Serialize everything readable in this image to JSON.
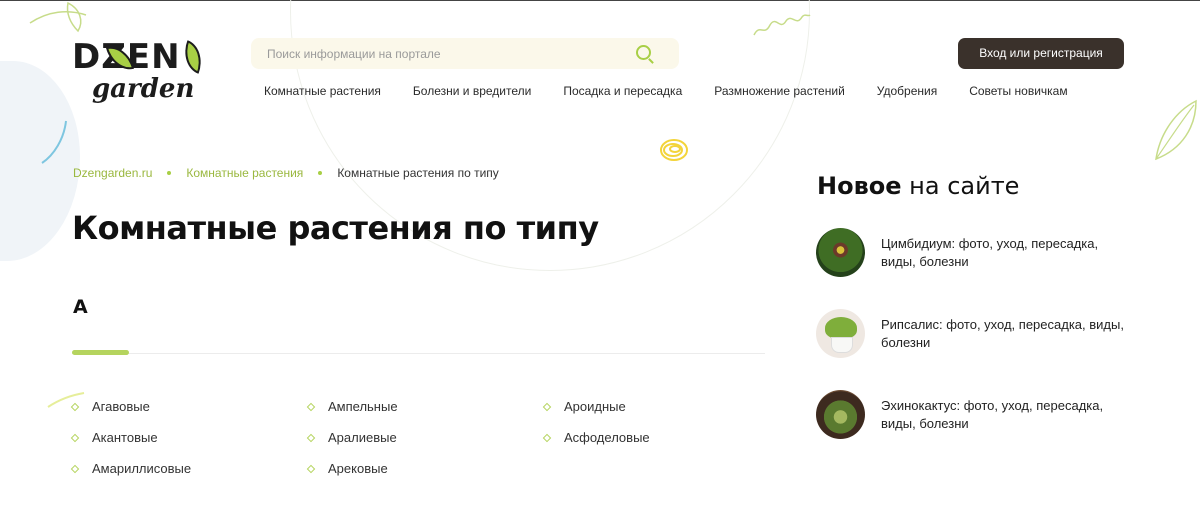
{
  "header": {
    "logo": {
      "top": "DZEN",
      "bottom": "garden"
    },
    "search": {
      "placeholder": "Поиск информации на портале"
    },
    "login_label": "Вход или регистрация",
    "nav": [
      {
        "label": "Комнатные растения"
      },
      {
        "label": "Болезни и вредители"
      },
      {
        "label": "Посадка и пересадка"
      },
      {
        "label": "Размножение растений"
      },
      {
        "label": "Удобрения"
      },
      {
        "label": "Советы новичкам"
      }
    ]
  },
  "breadcrumb": [
    {
      "label": "Dzengarden.ru"
    },
    {
      "label": "Комнатные растения"
    },
    {
      "label": "Комнатные растения по типу"
    }
  ],
  "page_title": "Комнатные растения по типу",
  "section_letter": "А",
  "categories": {
    "col1": [
      "Агавовые",
      "Акантовые",
      "Амариллисовые"
    ],
    "col2": [
      "Ампельные",
      "Аралиевые",
      "Арековые"
    ],
    "col3": [
      "Ароидные",
      "Асфоделовые"
    ]
  },
  "sidebar": {
    "title_bold": "Новое",
    "title_rest": " на сайте",
    "items": [
      {
        "text": "Цимбидиум: фото, уход, пересадка, виды, болезни"
      },
      {
        "text": "Рипсалис: фото, уход, пересадка, виды, болезни"
      },
      {
        "text": "Эхинокактус: фото, уход, пересадка, виды, болезни"
      }
    ]
  },
  "colors": {
    "accent": "#a8cf45",
    "button": "#3a312b",
    "search_bg": "#fbf8ea"
  }
}
